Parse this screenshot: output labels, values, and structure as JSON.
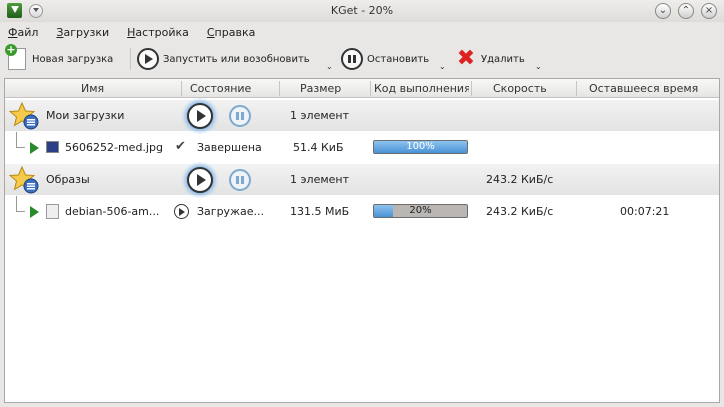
{
  "window": {
    "title": "KGet - 20%"
  },
  "menu": {
    "items": [
      {
        "pre": "",
        "ul": "Ф",
        "post": "айл"
      },
      {
        "pre": "",
        "ul": "З",
        "post": "агрузки"
      },
      {
        "pre": "",
        "ul": "Н",
        "post": "астройка"
      },
      {
        "pre": "",
        "ul": "С",
        "post": "правка"
      }
    ]
  },
  "toolbar": {
    "new_label": "Новая загрузка",
    "start_label": "Запустить или возобновить",
    "stop_label": "Остановить",
    "delete_label": "Удалить"
  },
  "columns": [
    "Имя",
    "Состояние",
    "Размер",
    "Код выполнения",
    "Скорость",
    "Оставшееся время"
  ],
  "groups": [
    {
      "name": "Мои загрузки",
      "size": "1 элемент",
      "speed": "",
      "items": [
        {
          "name": "5606252-med.jpg",
          "status": "Завершена",
          "size": "51.4 КиБ",
          "percent": 100,
          "percent_label": "100%",
          "speed": "",
          "remaining": ""
        }
      ]
    },
    {
      "name": "Образы",
      "size": "1 элемент",
      "speed": "243.2 КиБ/с",
      "items": [
        {
          "name": "debian-506-am...",
          "status": "Загружае...",
          "size": "131.5 МиБ",
          "percent": 20,
          "percent_label": "20%",
          "speed": "243.2 КиБ/с",
          "remaining": "00:07:21"
        }
      ]
    }
  ],
  "colors": {
    "progress_fill": "#4a92d6",
    "accent": "#7fb5e8",
    "download_arrow": "#2a8a2a",
    "delete_red": "#d22222"
  }
}
